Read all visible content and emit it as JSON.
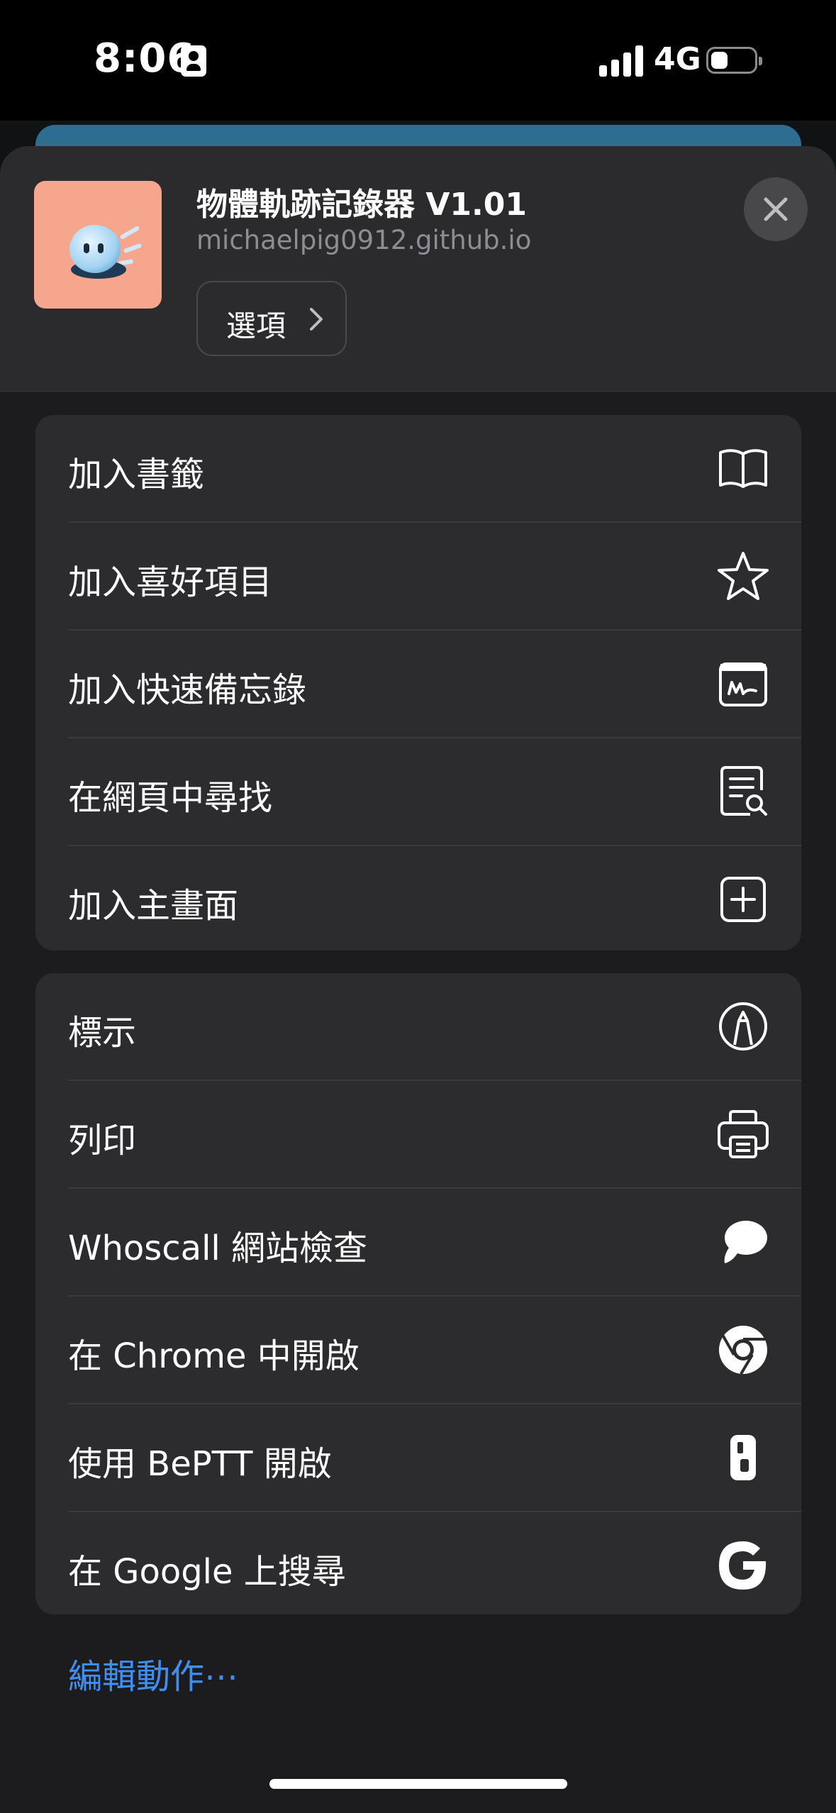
{
  "status": {
    "time": "8:06",
    "network": "4G",
    "battery_level_pct": 40
  },
  "header": {
    "app_title": "物體軌跡記錄器 V1.01",
    "domain": "michaelpig0912.github.io",
    "options_label": "選項"
  },
  "group1": [
    {
      "label": "加入書籤",
      "icon": "book-icon"
    },
    {
      "label": "加入喜好項目",
      "icon": "star-icon"
    },
    {
      "label": "加入快速備忘錄",
      "icon": "quick-note-icon"
    },
    {
      "label": "在網頁中尋找",
      "icon": "find-in-page-icon"
    },
    {
      "label": "加入主畫面",
      "icon": "add-square-icon"
    }
  ],
  "group2": [
    {
      "label": "標示",
      "icon": "markup-icon"
    },
    {
      "label": "列印",
      "icon": "printer-icon"
    },
    {
      "label": "Whoscall 網站檢查",
      "icon": "whoscall-icon"
    },
    {
      "label": "在 Chrome 中開啟",
      "icon": "chrome-icon"
    },
    {
      "label": "使用 BePTT 開啟",
      "icon": "beptt-icon"
    },
    {
      "label": "在 Google 上搜尋",
      "icon": "google-icon"
    }
  ],
  "edit_actions_label": "編輯動作⋯",
  "colors": {
    "sheet": "#1c1c1e",
    "row": "#2c2c2e",
    "link": "#3f8ef0",
    "thumb": "#f7a68e"
  }
}
